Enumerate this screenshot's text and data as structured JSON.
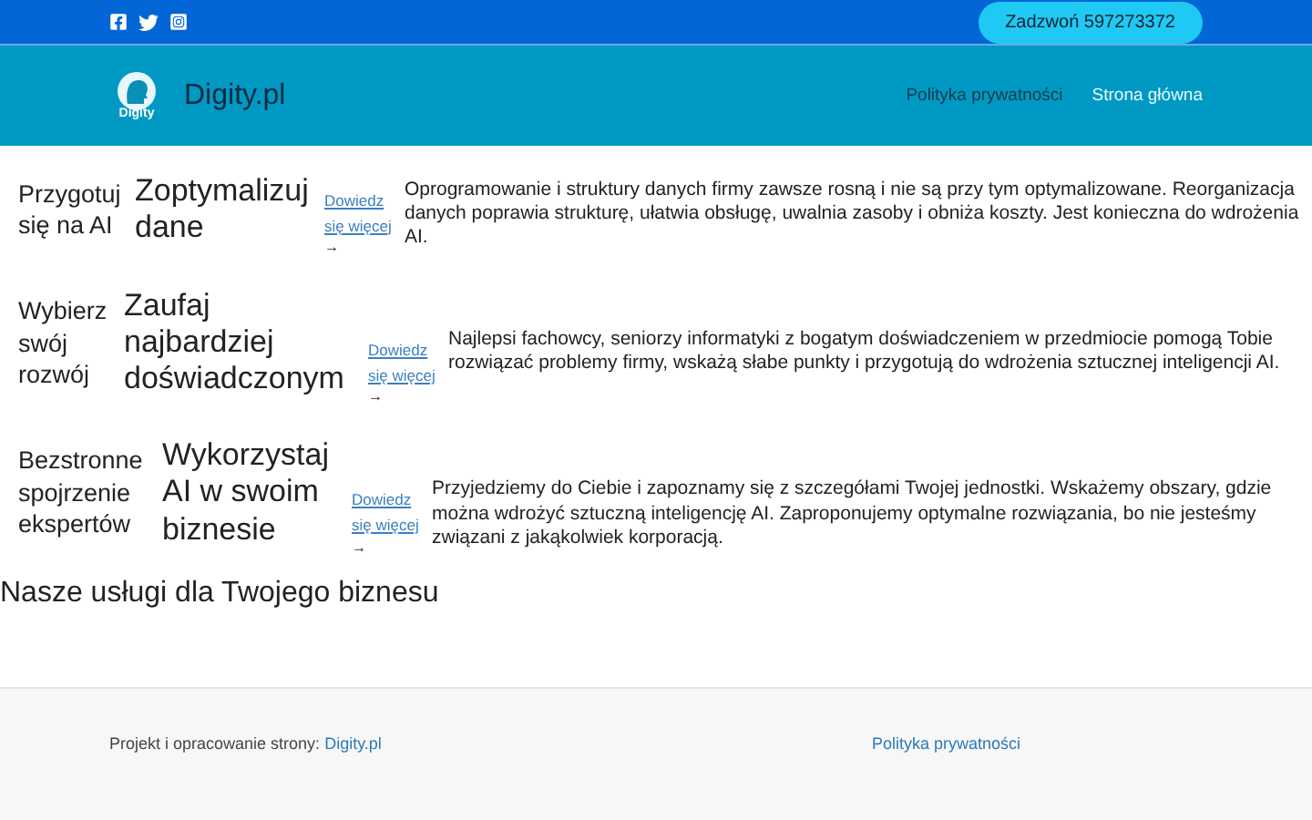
{
  "topbar": {
    "social": [
      {
        "kind": "facebook"
      },
      {
        "kind": "twitter"
      },
      {
        "kind": "instagram"
      }
    ],
    "call_button": "Zadzwoń 597273372"
  },
  "header": {
    "logo_caption": "Digity",
    "site_title": "Digity.pl",
    "nav": [
      {
        "label": "Polityka prywatności",
        "selected": false
      },
      {
        "label": "Strona główna",
        "selected": true
      }
    ]
  },
  "features": [
    {
      "label": "Przygotuj się na AI",
      "title": "Zoptymalizuj dane",
      "link": "Dowiedz się więcej",
      "arrow": "→",
      "text": "Oprogramowanie i struktury danych firmy zawsze rosną i nie są przy tym optymalizowane. Reorganizacja danych poprawia strukturę, ułatwia obsługę, uwalnia zasoby i obniża koszty. Jest konieczna do wdrożenia AI."
    },
    {
      "label": "Wybierz swój rozwój",
      "title": "Zaufaj najbardziej doświadczonym",
      "link": "Dowiedz się więcej",
      "arrow": "→",
      "text": "Najlepsi fachowcy, seniorzy informatyki z bogatym doświadczeniem w przedmiocie pomogą Tobie rozwiązać problemy firmy, wskażą słabe punkty i przygotują do wdrożenia sztucznej inteligencji AI."
    },
    {
      "label": "Bezstronne spojrzenie ekspertów",
      "title": "Wykorzystaj AI w swoim biznesie",
      "link": "Dowiedz się więcej",
      "arrow": "→",
      "text": "Przyjedziemy do Ciebie i zapoznamy się z szczegółami Twojej jednostki. Wskażemy obszary, gdzie można wdrożyć sztuczną inteligencję AI. Zaproponujemy optymalne rozwiązania, bo nie jesteśmy związani z jakąkolwiek korporacją."
    }
  ],
  "services_heading": "Nasze usługi dla Twojego biznesu",
  "footer": {
    "credit": "Projekt i opracowanie strony:",
    "credit_link": "Digity.pl",
    "policy_link": "Polityka prywatności"
  }
}
